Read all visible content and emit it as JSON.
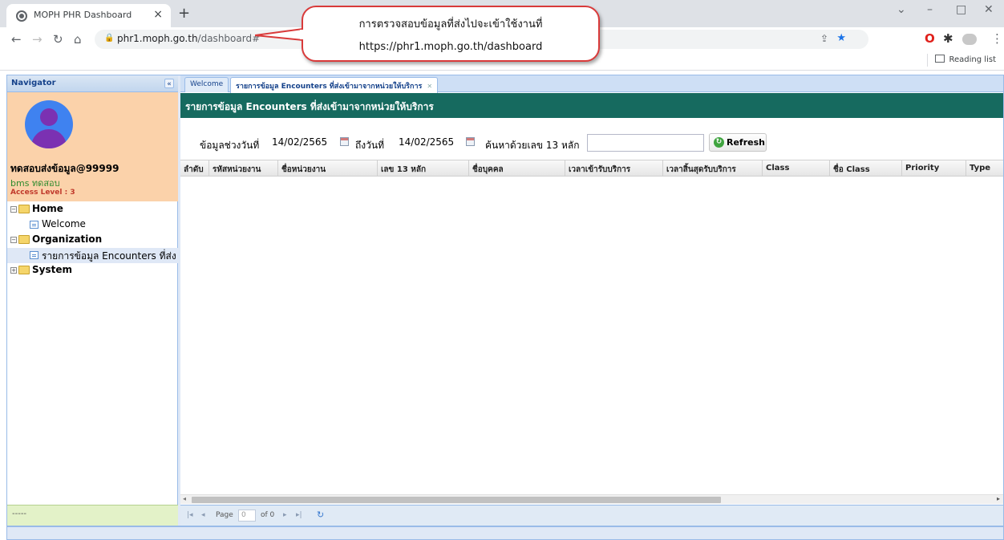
{
  "browser": {
    "tab_title": "MOPH PHR Dashboard",
    "url_host": "phr1.moph.go.th",
    "url_path": "/dashboard#",
    "reading_list": "Reading list"
  },
  "callout": {
    "line1": "การตรวจสอบข้อมูลที่ส่งไปจะเข้าใช้งานที่",
    "line2": "https://phr1.moph.go.th/dashboard"
  },
  "navigator": {
    "title": "Navigator",
    "user_name": "ทดสอบส่งข้อมูล@99999",
    "user_sub": "bms ทดสอบ",
    "access_level": "Access Level : 3",
    "tree": [
      {
        "label": "Home"
      },
      {
        "label": "Welcome"
      },
      {
        "label": "Organization"
      },
      {
        "label": "รายการข้อมูล Encounters ที่ส่ง"
      },
      {
        "label": "System"
      }
    ],
    "footer": "-----"
  },
  "main": {
    "tabs": [
      "Welcome",
      "รายการข้อมูล Encounters ที่ส่งเข้ามาจากหน่วยให้บริการ"
    ],
    "panel_title": "รายการข้อมูล Encounters ที่ส่งเข้ามาจากหน่วยให้บริการ",
    "filter": {
      "from_label": "ข้อมูลช่วงวันที่",
      "from_value": "14/02/2565",
      "to_label": "ถึงวันที่",
      "to_value": "14/02/2565",
      "cid_label": "ค้นหาด้วยเลข 13 หลัก",
      "cid_value": "",
      "refresh": "Refresh"
    },
    "columns": [
      "ลำดับ",
      "รหัสหน่วยงาน",
      "ชื่อหน่วยงาน",
      "เลข 13 หลัก",
      "ชื่อบุคคล",
      "เวลาเข้ารับบริการ",
      "เวลาสิ้นสุดรับบริการ",
      "Class",
      "ชื่อ Class",
      "Priority",
      "Type"
    ],
    "pager": {
      "page_label": "Page",
      "page_value": "0",
      "of_label": "of 0"
    }
  }
}
